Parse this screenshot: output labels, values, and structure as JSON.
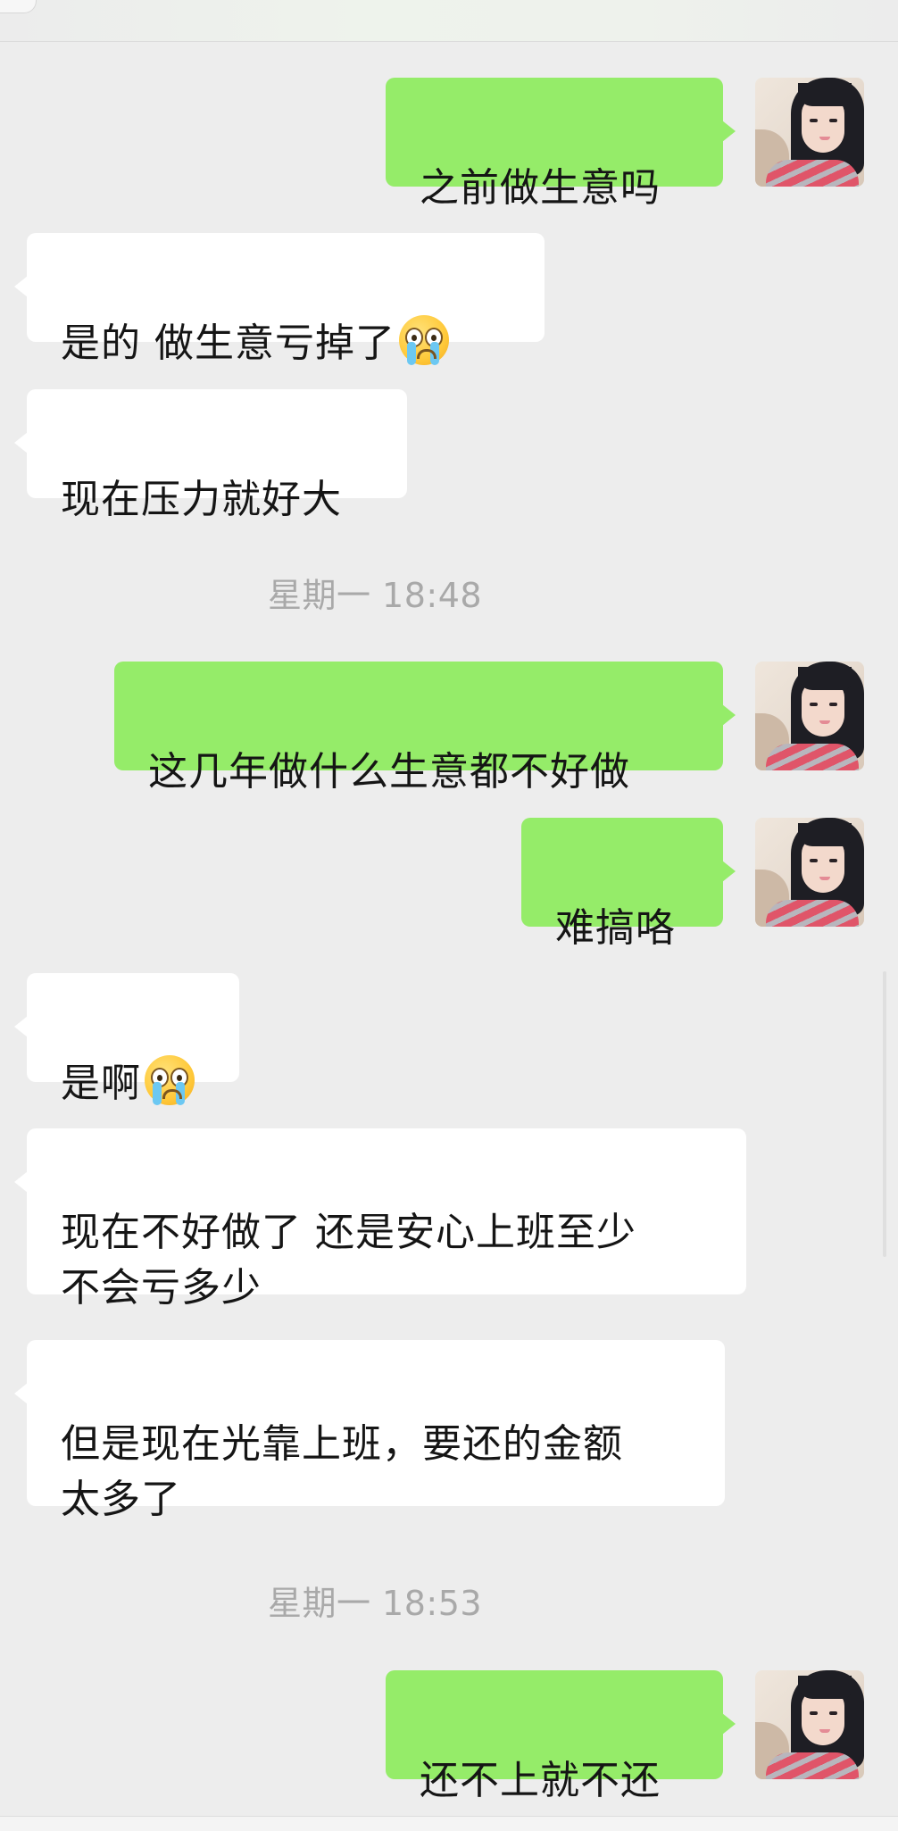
{
  "messages": [
    {
      "side": "sent",
      "text": "之前做生意吗"
    },
    {
      "side": "received",
      "text": "是的   做生意亏掉了",
      "emoji": "crying-face"
    },
    {
      "side": "received",
      "text": "现在压力就好大"
    },
    {
      "side": "sent",
      "text": "这几年做什么生意都不好做"
    },
    {
      "side": "sent",
      "text": "难搞咯"
    },
    {
      "side": "received",
      "text": "是啊",
      "emoji": "crying-face"
    },
    {
      "side": "received",
      "text": "现在不好做了  还是安心上班至少\n不会亏多少"
    },
    {
      "side": "received",
      "text": "但是现在光靠上班，要还的金额\n太多了"
    },
    {
      "side": "sent",
      "text": "还不上就不还"
    }
  ],
  "timestamps": [
    "星期一 18:48",
    "星期一 18:53"
  ],
  "colors": {
    "sent_bubble": "#95ec69",
    "received_bubble": "#ffffff",
    "background": "#ededed",
    "timestamp_text": "#a9a9a9"
  }
}
